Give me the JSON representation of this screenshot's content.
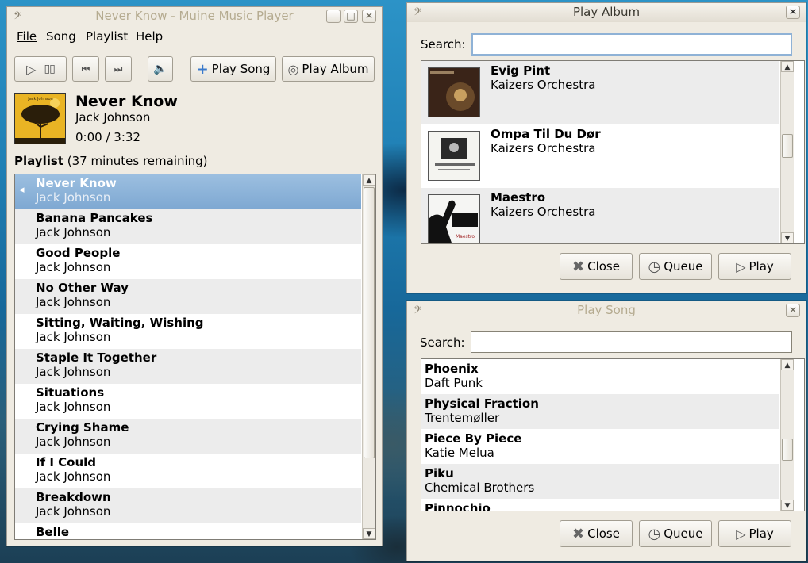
{
  "main": {
    "title": "Never Know - Muine Music Player",
    "menu": [
      "File",
      "Song",
      "Playlist",
      "Help"
    ],
    "toolbar": {
      "play_song": "Play Song",
      "play_album": "Play Album"
    },
    "now": {
      "title": "Never Know",
      "artist": "Jack Johnson",
      "time": "0:00 / 3:32"
    },
    "playlist_label": "Playlist",
    "playlist_remaining": "(37 minutes remaining)",
    "playlist": [
      {
        "title": "Never Know",
        "artist": "Jack Johnson"
      },
      {
        "title": "Banana Pancakes",
        "artist": "Jack Johnson"
      },
      {
        "title": "Good People",
        "artist": "Jack Johnson"
      },
      {
        "title": "No Other Way",
        "artist": "Jack Johnson"
      },
      {
        "title": "Sitting, Waiting, Wishing",
        "artist": "Jack Johnson"
      },
      {
        "title": "Staple It Together",
        "artist": "Jack Johnson"
      },
      {
        "title": "Situations",
        "artist": "Jack Johnson"
      },
      {
        "title": "Crying Shame",
        "artist": "Jack Johnson"
      },
      {
        "title": "If I Could",
        "artist": "Jack Johnson"
      },
      {
        "title": "Breakdown",
        "artist": "Jack Johnson"
      },
      {
        "title": "Belle",
        "artist": ""
      }
    ]
  },
  "album_dialog": {
    "title": "Play Album",
    "search_label": "Search:",
    "search_value": "",
    "albums": [
      {
        "title": "Evig Pint",
        "artist": "Kaizers Orchestra"
      },
      {
        "title": "Ompa Til Du Dør",
        "artist": "Kaizers Orchestra"
      },
      {
        "title": "Maestro",
        "artist": "Kaizers Orchestra"
      }
    ],
    "close": "Close",
    "queue": "Queue",
    "play": "Play"
  },
  "song_dialog": {
    "title": "Play Song",
    "search_label": "Search:",
    "search_value": "",
    "songs": [
      {
        "title": "Phoenix",
        "artist": "Daft Punk"
      },
      {
        "title": "Physical Fraction",
        "artist": "Trentemøller"
      },
      {
        "title": "Piece By Piece",
        "artist": "Katie Melua"
      },
      {
        "title": "Piku",
        "artist": "Chemical Brothers"
      },
      {
        "title": "Pinnochio",
        "artist": ""
      }
    ],
    "close": "Close",
    "queue": "Queue",
    "play": "Play"
  }
}
